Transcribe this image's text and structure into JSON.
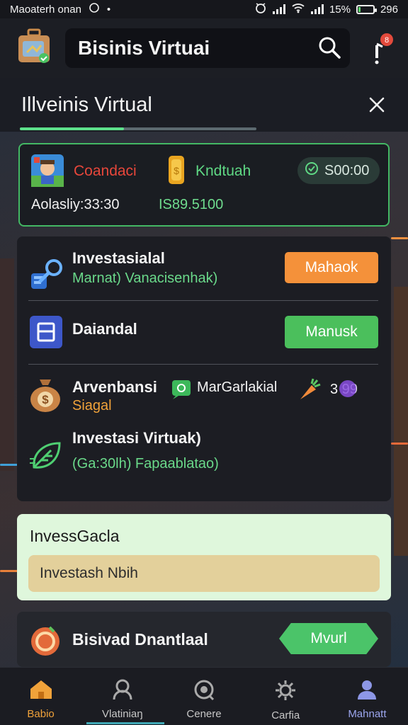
{
  "status_bar": {
    "app_name": "Maoaterh onan",
    "battery": "15%",
    "time": "296",
    "battery_level": 0.15
  },
  "header": {
    "title": "Bisinis Virtuai"
  },
  "tab": {
    "label": "Illveinis Virtual",
    "progress": 0.44
  },
  "summary": {
    "red_label": "Coandaci",
    "green_label": "Kndtuah",
    "pill_value": "S00:00",
    "info_label": "Aolasliy:33:30",
    "info_value": "IS89.5100",
    "colors": {
      "border": "#43b864",
      "red": "#e8473b",
      "green": "#5fd884"
    }
  },
  "rows": {
    "row1": {
      "title": "Investasialal",
      "subtitle": "Marnat) Vanacisenhak)",
      "button": "Mahaok"
    },
    "row2": {
      "title": "Daiandal",
      "button": "Manusk"
    },
    "row3": {
      "title": "Arvenbansi",
      "subtitle": "Siagal",
      "badge_label": "MarGarlakial",
      "value": "3 99"
    },
    "row4": {
      "title": "Investasi Virtuak)",
      "subtitle": "(Ga:30lh) Fapaablatao)"
    }
  },
  "promo": {
    "heading": "InvessGacla",
    "inner_text": "Investash Nbih"
  },
  "card4": {
    "title": "Bisivad Dnantlaal",
    "button": "Mvurl"
  },
  "bottom_nav": [
    {
      "label": "Babio",
      "icon": "home-icon"
    },
    {
      "label": "Vlatiniaŋ",
      "icon": "person-icon"
    },
    {
      "label": "Cenere",
      "icon": "camera-icon"
    },
    {
      "label": "Carfia",
      "icon": "gear-icon"
    },
    {
      "label": "Mahnatt",
      "icon": "user-icon"
    }
  ]
}
